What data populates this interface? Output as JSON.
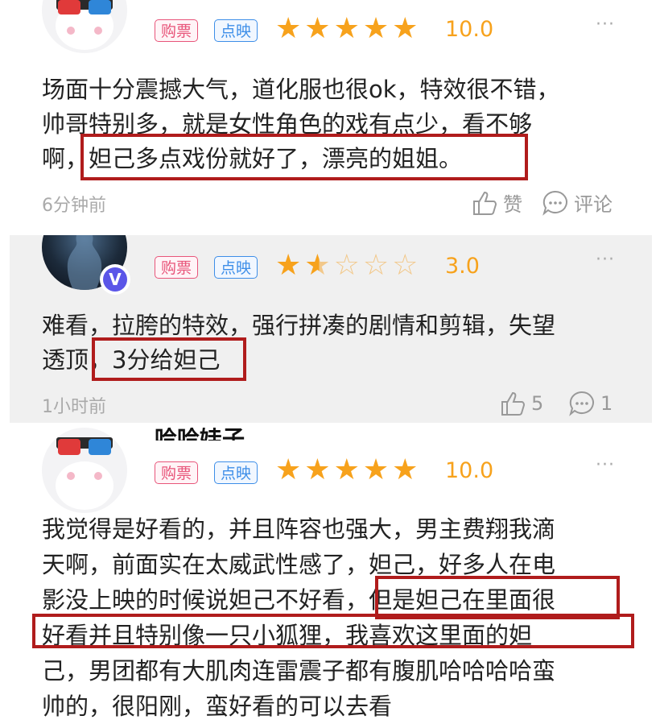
{
  "reviews": [
    {
      "tags": {
        "buy": "购票",
        "view": "点映"
      },
      "rating": 5,
      "score": "10.0",
      "more": "···",
      "lines": [
        "场面十分震撼大气，道化服也很ok，特效很不错，",
        "帅哥特别多，就是女性角色的戏有点少，看不够",
        "啊，妲己多点戏份就好了，漂亮的姐姐。"
      ],
      "time": "6分钟前",
      "like_label": "赞",
      "comment_label": "评论"
    },
    {
      "tags": {
        "buy": "购票",
        "view": "点映"
      },
      "rating": 1.5,
      "score": "3.0",
      "more": "···",
      "lines": [
        "难看，拉胯的特效，强行拼凑的剧情和剪辑，失望",
        "透顶，3分给妲己"
      ],
      "time": "1小时前",
      "like_count": "5",
      "comment_count": "1",
      "badge": "V"
    },
    {
      "name": "哈哈娃子",
      "tags": {
        "buy": "购票",
        "view": "点映"
      },
      "rating": 5,
      "score": "10.0",
      "more": "···",
      "lines": [
        "我觉得是好看的，并且阵容也强大，男主费翔我滴",
        "天啊，前面实在太威武性感了，妲己，好多人在电",
        "影没上映的时候说妲己不好看，但是妲己在里面很",
        "好看并且特别像一只小狐狸，我喜欢这里面的妲",
        "己，男团都有大肌肉连雷震子都有腹肌哈哈哈哈蛮",
        "帅的，很阳刚，蛮好看的可以去看"
      ]
    }
  ],
  "colors": {
    "star": "#f7a21c",
    "buy_tag": "#e8557a",
    "view_tag": "#3d8ee8",
    "highlight": "#b01c1c"
  }
}
